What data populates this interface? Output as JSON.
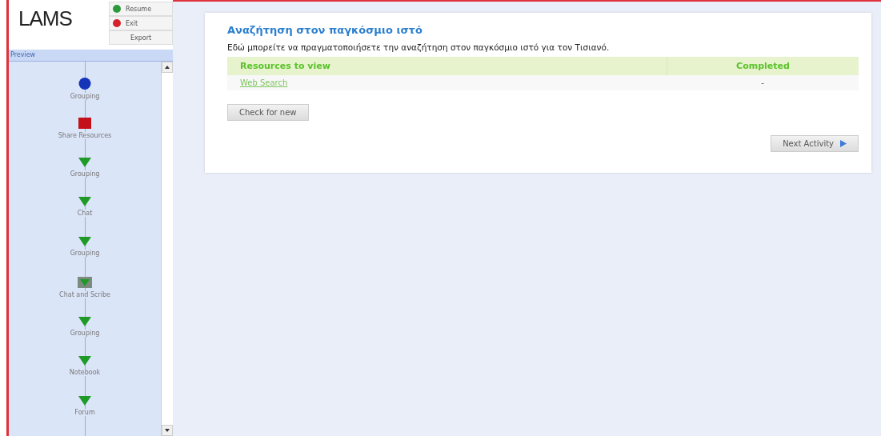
{
  "logo": "LAMS",
  "controls": [
    {
      "label": "Resume",
      "kind": "resume"
    },
    {
      "label": "Exit",
      "kind": "exit"
    },
    {
      "label": "Export",
      "kind": "plain"
    }
  ],
  "sidebar": {
    "title": "Preview",
    "activities": [
      {
        "label": "Grouping",
        "kind": "circle"
      },
      {
        "label": "Share Resources",
        "kind": "square"
      },
      {
        "label": "Grouping",
        "kind": "triangle"
      },
      {
        "label": "Chat",
        "kind": "triangle"
      },
      {
        "label": "Grouping",
        "kind": "triangle"
      },
      {
        "label": "Chat and Scribe",
        "kind": "boxed"
      },
      {
        "label": "Grouping",
        "kind": "triangle"
      },
      {
        "label": "Notebook",
        "kind": "triangle"
      },
      {
        "label": "Forum",
        "kind": "triangle"
      }
    ]
  },
  "content": {
    "title": "Αναζήτηση στον παγκόσμιο ιστό",
    "description": "Εδώ μπορείτε να πραγματοποιήσετε την αναζήτηση στον παγκόσμιο ιστό για τον Τισιανό.",
    "table": {
      "columns": [
        "Resources to view",
        "Completed"
      ],
      "rows": [
        [
          "Web Search",
          "-"
        ]
      ]
    },
    "check_button": "Check for new",
    "next_button": "Next Activity"
  }
}
